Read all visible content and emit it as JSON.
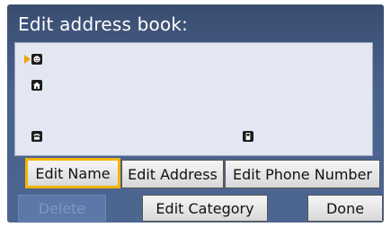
{
  "screen": {
    "title": "Edit address book:"
  },
  "icons": {
    "cursor": "cursor-arrow-icon",
    "name": "face-icon",
    "address": "house-icon",
    "phone": "phone-icon",
    "mobile": "mobile-phone-icon"
  },
  "buttons": {
    "edit_name": "Edit Name",
    "edit_address": "Edit Address",
    "edit_phone": "Edit Phone Number",
    "delete": "Delete",
    "edit_category": "Edit Category",
    "done": "Done"
  },
  "colors": {
    "background": "#4c6690",
    "panel": "#e3e7f2",
    "selection": "#f2b400",
    "cursor": "#f2a300"
  }
}
